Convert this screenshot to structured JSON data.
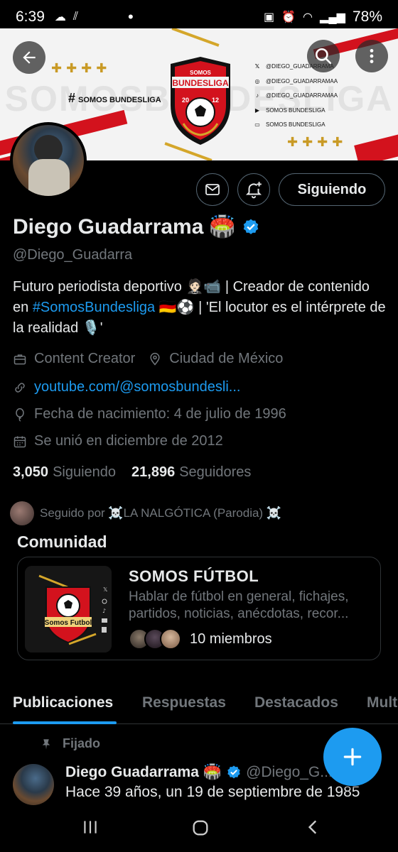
{
  "status": {
    "time": "6:39",
    "battery": "78%"
  },
  "banner": {
    "watermark": "SOMOSBUNDESLIGA",
    "hashtag": "SOMOS BUNDESLIGA",
    "crosses": "✚✚✚✚",
    "logo_top": "SOMOS",
    "logo_title": "BUNDESLIGA",
    "logo_year_left": "20",
    "logo_year_right": "12",
    "socials": [
      "@DIEGO_GUADARRAMA",
      "@DIEGO_GUADARRAMAA",
      "@DIEGO_GUADARRAMAA",
      "SOMOS BUNDESLIGA",
      "SOMOS BUNDESLIGA"
    ],
    "social_icons": [
      "x-icon",
      "instagram-icon",
      "tiktok-icon",
      "youtube-icon",
      "twitch-icon"
    ]
  },
  "actions": {
    "follow_label": "Siguiendo"
  },
  "profile": {
    "name": "Diego Guadarrama",
    "name_emoji": "🏟️",
    "handle": "@Diego_Guadarra",
    "bio_1": "Futuro periodista deportivo 🤵🏻📹 | Creador de contenido en ",
    "bio_tag": "#SomosBundesliga",
    "bio_2": " 🇩🇪⚽ | 'El locutor es el intérprete de la realidad 🎙️'",
    "category": "Content Creator",
    "location": "Ciudad de México",
    "link": "youtube.com/@somosbundesli...",
    "birth": "Fecha de nacimiento: 4 de julio de 1996",
    "joined": "Se unió en diciembre de 2012",
    "following_count": "3,050",
    "following_label": "Siguiendo",
    "followers_count": "21,896",
    "followers_label": "Seguidores",
    "followed_by": "Seguido por ☠️LA NALGÓTICA (Parodia) ☠️"
  },
  "community": {
    "section_title": "Comunidad",
    "name": "SOMOS FÚTBOL",
    "description": "Hablar de fútbol en general, fichajes, partidos, noticias, anécdotas, recor...",
    "members": "10 miembros",
    "logo_text": "Somos Futbol"
  },
  "tabs": [
    "Publicaciones",
    "Respuestas",
    "Destacados",
    "Mult"
  ],
  "tweet": {
    "pinned_label": "Fijado",
    "author": "Diego Guadarrama",
    "author_emoji": "🏟️",
    "handle": "@Diego_G...",
    "text": "Hace 39 años, un 19 de septiembre de 1985"
  },
  "colors": {
    "accent": "#1d9bf0",
    "muted": "#71767b",
    "brand_red": "#d3121d"
  }
}
